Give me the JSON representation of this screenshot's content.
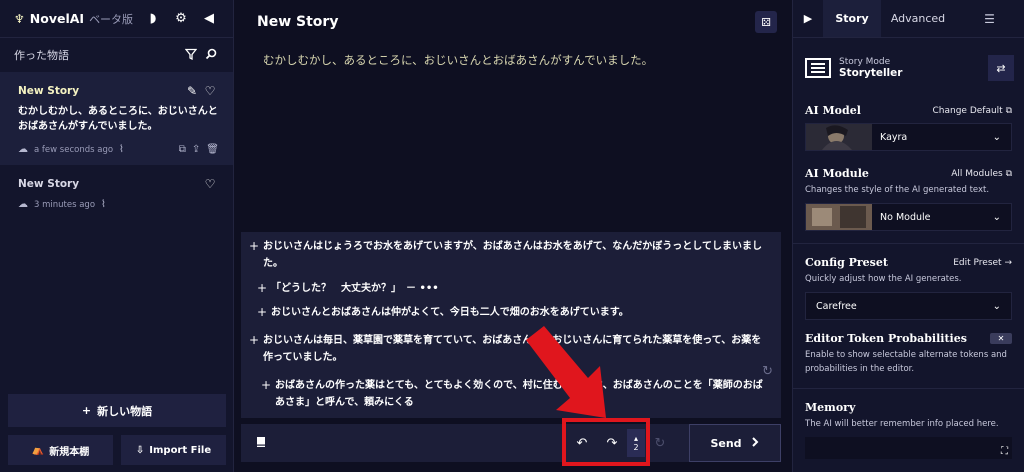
{
  "app": {
    "logo": "♆",
    "name": "NovelAI",
    "beta": "ベータ版",
    "theme_icon": "◗",
    "settings_icon": "⚙",
    "collapse_icon": "◀"
  },
  "sidebar": {
    "list_title": "作った物語",
    "stories": [
      {
        "title": "New Story",
        "preview": "むかしむかし、あるところに、おじいさんとおばあさんがすんでいました。",
        "time": "a few seconds ago"
      },
      {
        "title": "New Story",
        "preview": "",
        "time": "3 minutes ago"
      }
    ],
    "new_story_label": "新しい物語",
    "new_folder_label": "新規本棚",
    "import_label": "Import File"
  },
  "editor": {
    "title": "New Story",
    "story_text": "むかしむかし、あるところに、おじいさんとおばあさんがすんでいました。",
    "suggestions": [
      "おじいさんはじょうろでお水をあげていますが、おばあさんはお水をあげて、なんだかぼうっとしてしまいました。",
      "「どうした？　大丈夫か？」　－ •••",
      "おじいさんとおばあさんは仲がよくて、今日も二人で畑のお水をあげています。",
      "おじいさんは毎日、薬草園で薬草を育てていて、おばあさんは、おじいさんに育てられた薬草を使って、お薬を作っていました。",
      "おばあさんの作った薬はとても、とてもよく効くので、村に住む人たちは、おばあさんのことを「薬師のおばあさま」と呼んで、頼みにくる"
    ],
    "retry_count": "2",
    "send_label": "Send"
  },
  "right_panel": {
    "tab_story": "Story",
    "tab_advanced": "Advanced",
    "story_mode_label": "Story Mode",
    "story_mode_value": "Storyteller",
    "ai_model": {
      "title": "AI Model",
      "link": "Change Default",
      "value": "Kayra"
    },
    "ai_module": {
      "title": "AI Module",
      "link": "All Modules",
      "desc": "Changes the style of the AI generated text.",
      "value": "No Module"
    },
    "config_preset": {
      "title": "Config Preset",
      "link": "Edit Preset",
      "desc": "Quickly adjust how the AI generates.",
      "value": "Carefree"
    },
    "token_probs": {
      "title": "Editor Token Probabilities",
      "desc": "Enable to show selectable alternate tokens and probabilities in the editor."
    },
    "memory": {
      "title": "Memory",
      "desc": "The AI will better remember info placed here."
    }
  },
  "colors": {
    "accent": "#f5f3c2",
    "annotation": "#e0161d"
  }
}
